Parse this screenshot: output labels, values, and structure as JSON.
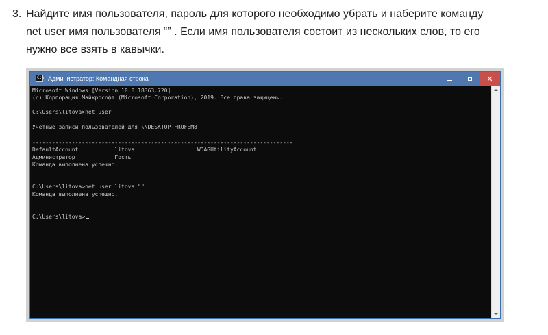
{
  "instruction": {
    "number": "3.",
    "lines": [
      "Найдите имя пользователя, пароль для которого необходимо убрать и наберите команду",
      "net user имя пользователя “” . Если имя пользователя состоит из нескольких слов, то его",
      "нужно все взять в кавычки."
    ]
  },
  "window": {
    "title": "Администратор: Командная строка",
    "icon": "cmd-icon",
    "icon_prompt": "C:\\",
    "close_glyph": "✕"
  },
  "console": {
    "lines": [
      "Microsoft Windows [Version 10.0.18363.720]",
      "(c) Корпорация Майкрософт (Microsoft Corporation), 2019. Все права защищены.",
      "",
      "C:\\Users\\litova>net user",
      "",
      "Учетные записи пользователей для \\\\DESKTOP-FRUFEM8",
      "",
      "-------------------------------------------------------------------------------",
      "DefaultAccount           litova                   WDAGUtilityAccount",
      "Администратор            Гость",
      "Команда выполнена успешно.",
      "",
      "",
      "C:\\Users\\litova>net user litova \"\"",
      "Команда выполнена успешно.",
      "",
      "",
      "C:\\Users\\litova>"
    ]
  },
  "colors": {
    "titlebar": "#4f78b0",
    "close_button": "#c94f4a",
    "console_bg": "#0c0c0c",
    "console_text": "#c8c8c8"
  }
}
